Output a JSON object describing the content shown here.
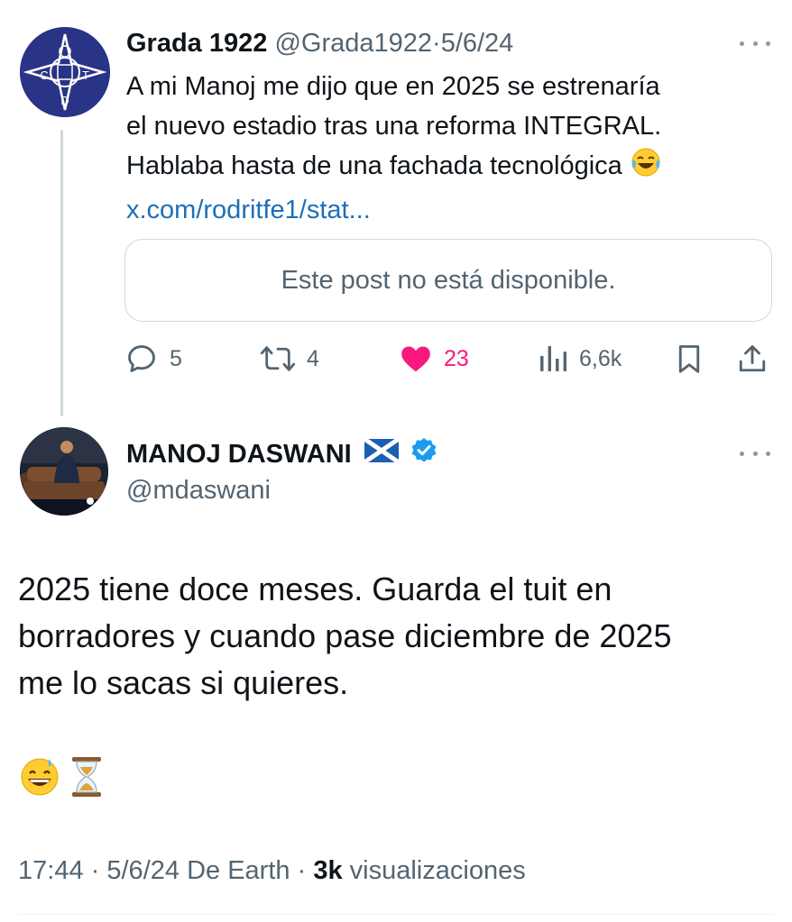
{
  "parent_tweet": {
    "name": "Grada 1922",
    "handle": "@Grada1922",
    "separator": "·",
    "date": "5/6/24",
    "text_lines": [
      "A mi Manoj me dijo que en 2025 se estrenaría",
      "el nuevo estadio tras una reforma INTEGRAL.",
      "Hablaba hasta de una fachada tecnológica"
    ],
    "emoji": "face-with-tears-of-joy",
    "link": "x.com/rodritfe1/stat...",
    "quote_card": "Este post no está disponible.",
    "avatar_letters": [
      "C",
      "T",
      "D"
    ],
    "stats": {
      "replies": "5",
      "reposts": "4",
      "likes": "23",
      "views": "6,6k"
    }
  },
  "main_tweet": {
    "name": "MANOJ DASWANI",
    "flag": "scotland-flag",
    "verified": true,
    "handle": "@mdaswani",
    "text_lines": [
      "2025 tiene doce meses. Guarda el tuit en",
      "borradores y cuando pase diciembre de 2025",
      "me lo sacas si quieres."
    ],
    "emojis": [
      "grinning-face-with-sweat",
      "hourglass"
    ],
    "meta": {
      "time": "17:44",
      "sep1": "·",
      "date": "5/6/24",
      "source": "De Earth",
      "sep2": "·",
      "views_count": "3k",
      "views_label": "visualizaciones"
    }
  },
  "colors": {
    "text": "#0f1419",
    "secondary": "#536471",
    "link": "#1d6fb8",
    "like": "#f91880",
    "verified": "#1d9bf0",
    "badge_blue": "#2a3486"
  }
}
